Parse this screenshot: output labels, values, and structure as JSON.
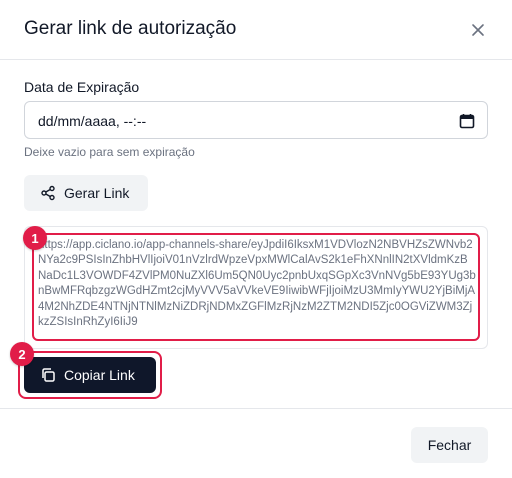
{
  "dialog": {
    "title": "Gerar link de autorização"
  },
  "form": {
    "label": "Data de Expiração",
    "date_value": "dd/mm/aaaa, --:--",
    "hint": "Deixe vazio para sem expiração"
  },
  "actions": {
    "generate_label": "Gerar Link",
    "copy_label": "Copiar Link",
    "close_label": "Fechar"
  },
  "generated_link": "https://app.ciclano.io/app-channels-share/eyJpdiI6IksxM1VDVlozN2NBVHZsZWNvb2NYa2c9PSIsInZhbHVlIjoiV01nVzlrdWpzeVpxMWlCalAvS2k1eFhXNnlIN2tXVldmKzBNaDc1L3VOWDF4ZVlPM0NuZXl6Um5QN0Uyc2pnbUxqSGpXc3VnNVg5bE93YUg3bnBwMFRqbzgzWGdHZmt2cjMyVVV5aVVkeVE9IiwibWFjIjoiMzU3MmIyYWU2YjBiMjA4M2NhZDE4NTNjNTNlMzNiZDRjNDMxZGFlMzRjNzM2ZTM2NDI5Zjc0OGViZWM3ZjkzZSIsInRhZyI6IiJ9",
  "annotations": {
    "badge_1": "1",
    "badge_2": "2",
    "highlight_color": "#e11d48"
  },
  "colors": {
    "primary_button": "#0f172a",
    "secondary_button": "#f1f3f5"
  },
  "icons": {
    "close": "close-icon",
    "calendar": "calendar-icon",
    "share": "share-icon",
    "copy": "copy-icon"
  }
}
